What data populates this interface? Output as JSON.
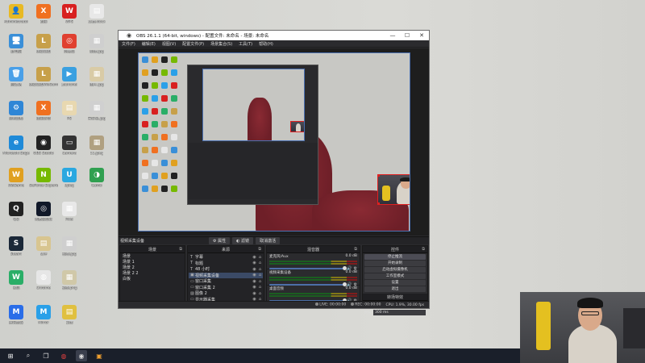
{
  "desktop": {
    "icons": [
      {
        "label": "Administrator",
        "color": "#e8b923",
        "glyph": "👤"
      },
      {
        "label": "此电脑",
        "color": "#3a8fd8",
        "glyph": "🖥"
      },
      {
        "label": "回收站",
        "color": "#4aa0e8",
        "glyph": "🗑"
      },
      {
        "label": "控制面板",
        "color": "#2f86d6",
        "glyph": "⚙"
      },
      {
        "label": "Microsoft Edge",
        "color": "#1f8ad8",
        "glyph": "e"
      },
      {
        "label": "WeGame",
        "color": "#e0a020",
        "glyph": "W"
      },
      {
        "label": "QQ",
        "color": "#222",
        "glyph": "Q"
      },
      {
        "label": "Steam",
        "color": "#1b2838",
        "glyph": "S"
      },
      {
        "label": "微信",
        "color": "#2aae67",
        "glyph": "W"
      },
      {
        "label": "腾讯会议",
        "color": "#2a6de8",
        "glyph": "M"
      },
      {
        "label": "迅雷",
        "color": "#f07020",
        "glyph": "X"
      },
      {
        "label": "英雄联盟",
        "color": "#c7a04a",
        "glyph": "L"
      },
      {
        "label": "英雄联盟WeGame版",
        "color": "#c7a04a",
        "glyph": "L"
      },
      {
        "label": "迅雷影音",
        "color": "#f07020",
        "glyph": "X"
      },
      {
        "label": "OBS Studio",
        "color": "#222",
        "glyph": "◉"
      },
      {
        "label": "GeForce Experience",
        "color": "#76b900",
        "glyph": "N"
      },
      {
        "label": "网易云音乐",
        "color": "#101828",
        "glyph": "◎"
      },
      {
        "label": "文件",
        "color": "#d8c590",
        "glyph": "▤"
      },
      {
        "label": "Chrome",
        "color": "#e6e6e6",
        "glyph": "◍"
      },
      {
        "label": "Mirror",
        "color": "#2aa0e8",
        "glyph": "M"
      },
      {
        "label": "WPS",
        "color": "#d82020",
        "glyph": "W"
      },
      {
        "label": "网易云",
        "color": "#e04030",
        "glyph": "◎"
      },
      {
        "label": "Launcher",
        "color": "#3aa0e0",
        "glyph": "▶"
      },
      {
        "label": "PS",
        "color": "#e8d8b0",
        "glyph": "▤"
      },
      {
        "label": "Camera",
        "color": "#333",
        "glyph": "▭"
      },
      {
        "label": "Uplay",
        "color": "#2aa8e0",
        "glyph": "U"
      },
      {
        "label": "Pixel",
        "color": "#e8e8e8",
        "glyph": "▦"
      },
      {
        "label": "截图.jpg",
        "color": "#cfcfcf",
        "glyph": "▦"
      },
      {
        "label": "截图.png",
        "color": "#d0c8a8",
        "glyph": "▦"
      },
      {
        "label": "录像",
        "color": "#e0c040",
        "glyph": "▤"
      },
      {
        "label": "文档.docx",
        "color": "#e8e8e8",
        "glyph": "▤"
      },
      {
        "label": "新建.jpg",
        "color": "#cfcfcf",
        "glyph": "▦"
      },
      {
        "label": "图片.jpg",
        "color": "#d9cba6",
        "glyph": "▦"
      },
      {
        "label": "未命名.jpg",
        "color": "#d0d0d0",
        "glyph": "▦"
      },
      {
        "label": "11.jpeg",
        "color": "#b0a080",
        "glyph": "▦"
      },
      {
        "label": "Camo",
        "color": "#30a050",
        "glyph": "◑"
      }
    ]
  },
  "obs": {
    "title": "OBS 26.1.1 (64-bit, windows) - 配置文件: 未命名 - 场景: 未命名",
    "controls": {
      "minimize": "—",
      "maximize": "☐",
      "close": "✕"
    },
    "menu": [
      "文件(F)",
      "编辑(E)",
      "视图(V)",
      "配置文件(P)",
      "场景集合(S)",
      "工具(T)",
      "帮助(H)"
    ],
    "current_scene": "视频采集设备",
    "scene_tabs": {
      "properties": "属性",
      "filters": "滤镜",
      "deactivate": "取消激活"
    },
    "docks": {
      "scenes": {
        "title": "场景",
        "items": [
          "场景",
          "场景 1",
          "场景 2",
          "场景 2 2",
          "白板"
        ]
      },
      "sources": {
        "title": "来源",
        "items": [
          {
            "icon": "T",
            "label": "字幕"
          },
          {
            "icon": "T",
            "label": "标题"
          },
          {
            "icon": "T",
            "label": "48 小时"
          },
          {
            "icon": "▣",
            "label": "视频采集设备"
          },
          {
            "icon": "▭",
            "label": "窗口采集"
          },
          {
            "icon": "▭",
            "label": "窗口采集 2"
          },
          {
            "icon": "▨",
            "label": "图像 2"
          },
          {
            "icon": "▭",
            "label": "显示器采集"
          },
          {
            "icon": "T",
            "label": "TTT"
          }
        ]
      },
      "mixer": {
        "title": "混音器",
        "channels": [
          {
            "name": "麦克风/Aux",
            "db": "0.0 dB"
          },
          {
            "name": "视频采集设备",
            "db": "0.0 dB"
          },
          {
            "name": "桌面音频",
            "db": "0.0 dB"
          }
        ]
      },
      "controls": {
        "title": "控件",
        "buttons": [
          "停止推流",
          "开始录制",
          "启动虚拟摄像机",
          "工作室模式",
          "设置",
          "退出"
        ]
      },
      "transitions": {
        "title": "转场特效",
        "type": "淡出",
        "duration_label": "时长",
        "duration": "300 ms"
      }
    },
    "status": {
      "live_label": "LIVE:",
      "live_time": "00:00:00",
      "rec_label": "REC:",
      "rec_time": "00:00:00",
      "cpu": "CPU: 1.9%, 30.00 fps"
    }
  },
  "taskbar": {
    "items": [
      "windows-start",
      "search",
      "task-view",
      "chrome",
      "obs",
      "wps"
    ]
  }
}
